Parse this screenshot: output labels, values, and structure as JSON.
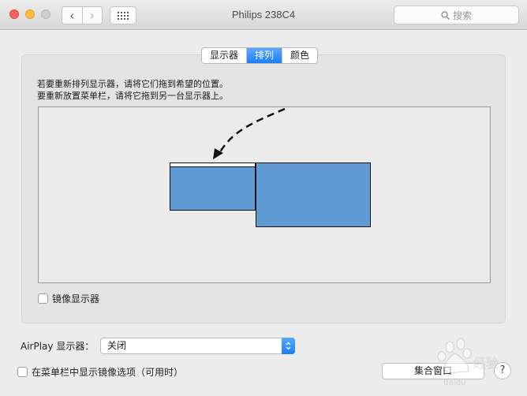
{
  "window": {
    "title": "Philips 238C4",
    "search_placeholder": "搜索"
  },
  "tabs": [
    {
      "label": "显示器"
    },
    {
      "label": "排列",
      "active": true
    },
    {
      "label": "颜色"
    }
  ],
  "arrangement": {
    "instruction_line1": "若要重新排列显示器，请将它们拖到希望的位置。",
    "instruction_line2": "要重新放置菜单栏，请将它拖到另一台显示器上。",
    "mirror_label": "镜像显示器",
    "mirror_checked": false
  },
  "airplay": {
    "label": "AirPlay 显示器：",
    "value": "关闭"
  },
  "footer": {
    "show_mirroring_label": "在菜单栏中显示镜像选项（可用时）",
    "show_mirroring_checked": false,
    "gather_windows_label": "集合窗口",
    "help_label": "?"
  },
  "colors": {
    "accent": "#1b7ff6",
    "display_fill": "#5f9ad5"
  },
  "watermark": {
    "text": "Baidu 经验"
  }
}
